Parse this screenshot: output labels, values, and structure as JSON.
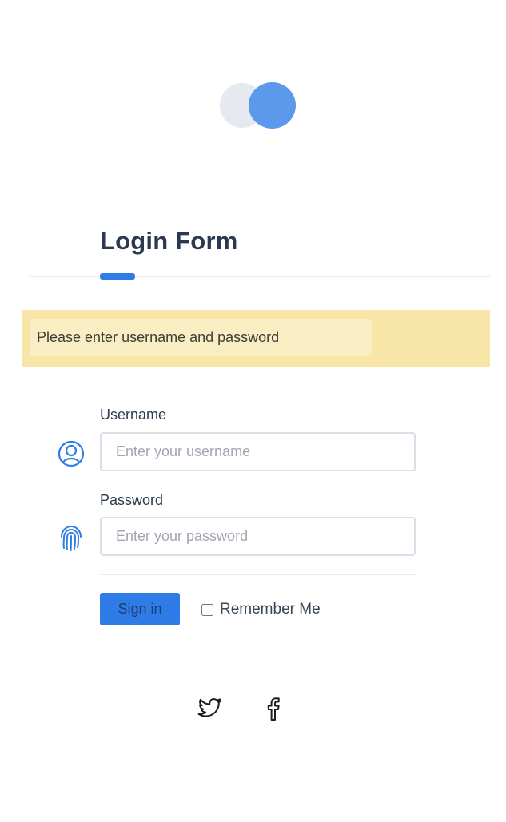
{
  "form": {
    "title": "Login Form",
    "alert": "Please enter username and password",
    "username": {
      "label": "Username",
      "placeholder": "Enter your username",
      "icon": "user-circle-icon"
    },
    "password": {
      "label": "Password",
      "placeholder": "Enter your password",
      "icon": "fingerprint-icon"
    },
    "sign_in_label": "Sign in",
    "remember_label": "Remember Me",
    "remember_checked": false
  },
  "social": [
    {
      "name": "twitter-icon"
    },
    {
      "name": "facebook-icon"
    }
  ],
  "colors": {
    "accent": "#2f7ce6",
    "logo_primary": "#5b99ea",
    "logo_secondary": "#e6eaf0",
    "alert_background": "#f7e6a8"
  }
}
